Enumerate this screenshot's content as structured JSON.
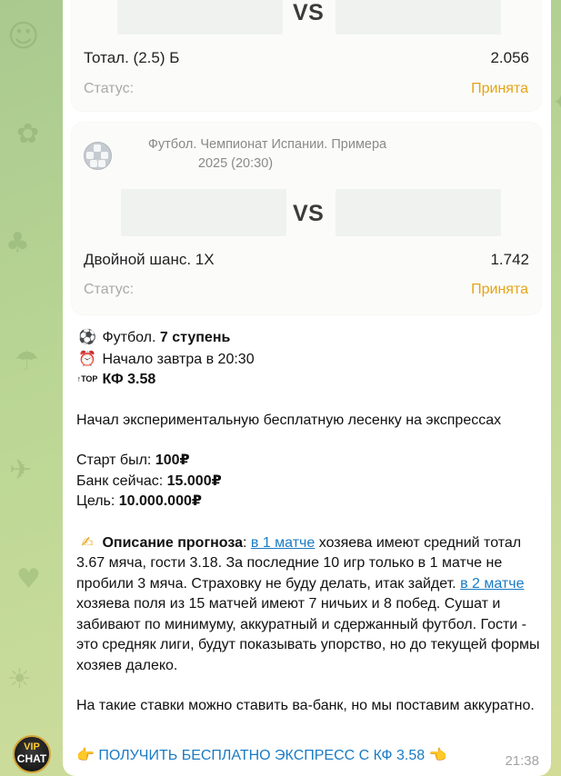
{
  "cards": [
    {
      "vs": "VS",
      "bet": "Тотал. (2.5) Б",
      "odds": "2.056",
      "status_label": "Статус:",
      "status_value": "Принята"
    },
    {
      "league_line1": "Футбол. Чемпионат Испании. Примера",
      "league_line2": "2025 (20:30)",
      "vs": "VS",
      "bet": "Двойной шанс. 1X",
      "odds": "1.742",
      "status_label": "Статус:",
      "status_value": "Принята"
    }
  ],
  "message": {
    "sport_emoji": "⚽",
    "sport_text": "Футбол.",
    "step": "7 ступень",
    "alarm_emoji": "⏰",
    "start": "Начало завтра в 20:30",
    "top_icon": "↑TOP",
    "kf": "КФ 3.58",
    "intro": "Начал экспериментальную бесплатную лесенку на экспрессах",
    "start_label": "Старт был:",
    "start_value": "100₽",
    "bank_label": "Банк сейчас:",
    "bank_value": "15.000₽",
    "goal_label": "Цель:",
    "goal_value": "10.000.000₽",
    "desc_emoji": "✍",
    "desc_label": "Описание прогноза",
    "desc_colon": ":",
    "link1": "в 1 матче",
    "text1": " хозяева имеют средний тотал 3.67 мяча, гости 3.18. За последние 10 игр только в 1 матче не пробили 3 мяча. Страховку не буду делать, итак зайдет. ",
    "link2": "в 2 матче",
    "text2": " хозяева поля из 15 матчей имеют 7 ничьих и 8 побед. Сушат и забивают по минимуму, аккуратный и сдержанный футбол. Гости - это средняк лиги, будут показывать упорство, но до текущей формы хозяев далеко.",
    "allin": "На такие ставки можно ставить ва-банк, но мы поставим аккуратно.",
    "cta_left": "👉",
    "cta_text": "ПОЛУЧИТЬ БЕСПЛАТНО ЭКСПРЕСС С КФ 3.58",
    "cta_right": "👈",
    "time": "21:38"
  },
  "avatar": {
    "line1": "VIP",
    "line2": "CHAT"
  }
}
